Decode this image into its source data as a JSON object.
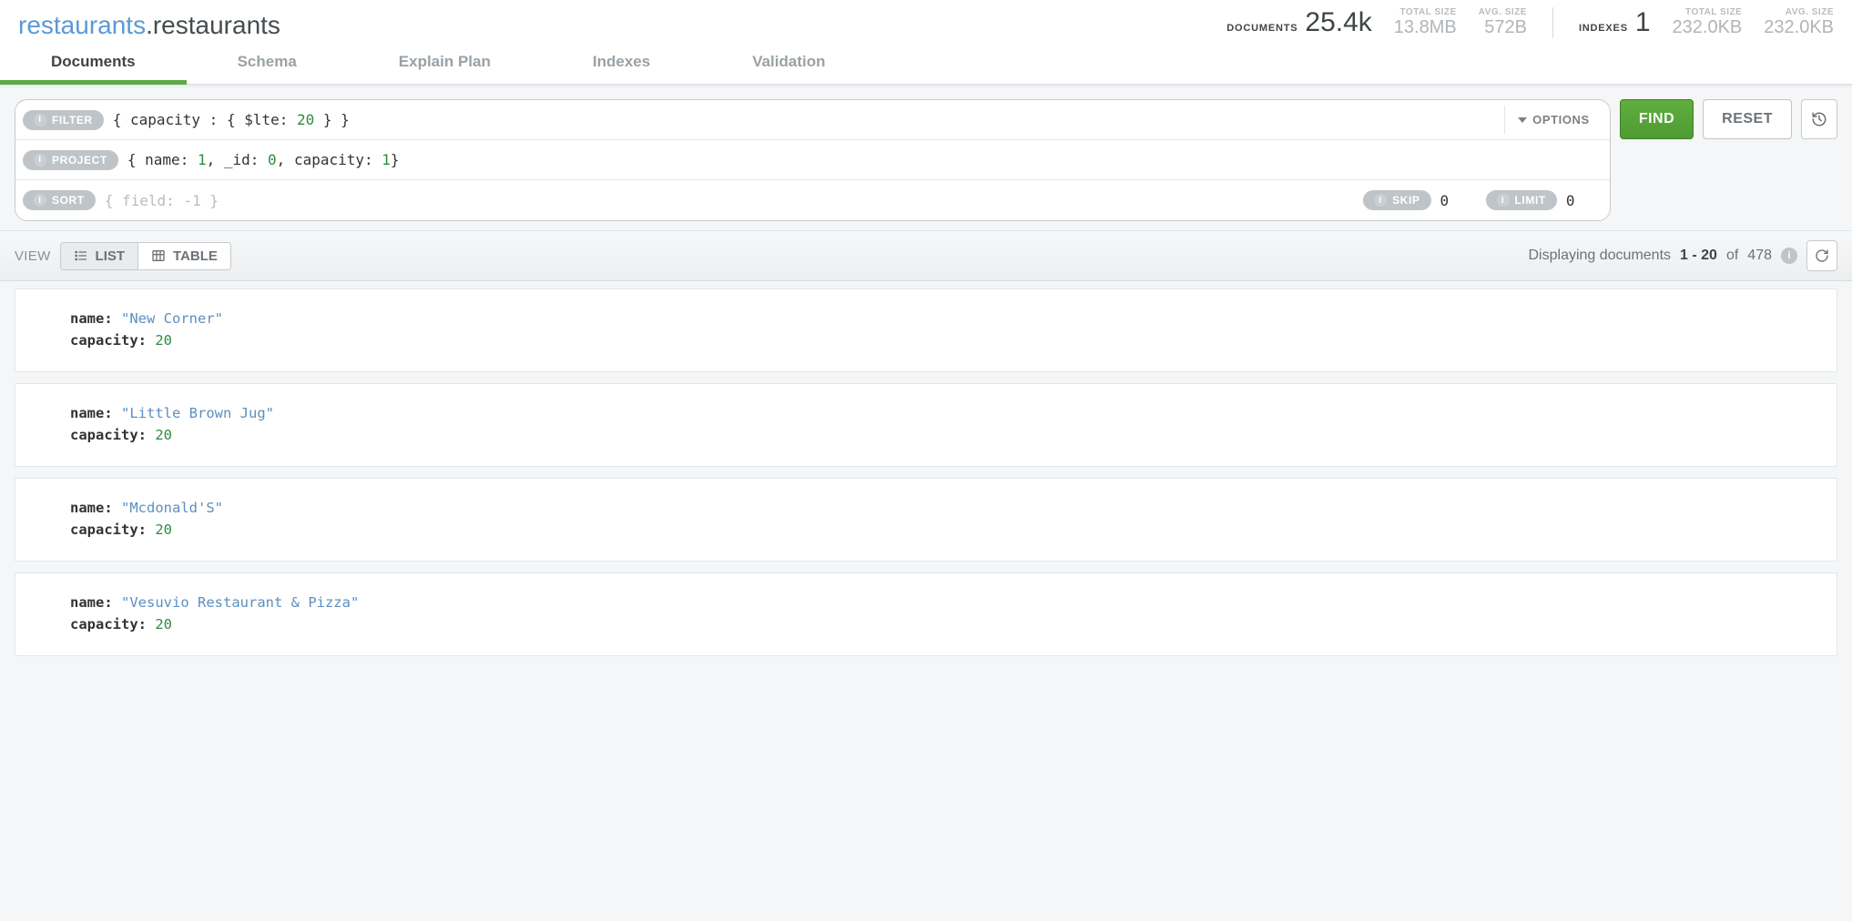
{
  "namespace": {
    "db": "restaurants",
    "coll": "restaurants"
  },
  "stats": {
    "documents": {
      "label": "DOCUMENTS",
      "value": "25.4k"
    },
    "doc_total_size": {
      "label": "TOTAL SIZE",
      "value": "13.8MB"
    },
    "doc_avg_size": {
      "label": "AVG. SIZE",
      "value": "572B"
    },
    "indexes": {
      "label": "INDEXES",
      "value": "1"
    },
    "idx_total_size": {
      "label": "TOTAL SIZE",
      "value": "232.0KB"
    },
    "idx_avg_size": {
      "label": "AVG. SIZE",
      "value": "232.0KB"
    }
  },
  "tabs": {
    "items": [
      {
        "label": "Documents",
        "active": true
      },
      {
        "label": "Schema"
      },
      {
        "label": "Explain Plan"
      },
      {
        "label": "Indexes"
      },
      {
        "label": "Validation"
      }
    ]
  },
  "query": {
    "filter_label": "FILTER",
    "filter_prefix": "{ capacity : { $lte: ",
    "filter_value": "20",
    "filter_suffix": " } }",
    "options_label": "OPTIONS",
    "project_label": "PROJECT",
    "project_value": "{ name: 1, _id: 0, capacity: 1}",
    "project_tokens": {
      "a": "{ name: ",
      "v1": "1",
      "b": ", _id: ",
      "v2": "0",
      "c": ", capacity: ",
      "v3": "1",
      "d": "}"
    },
    "sort_label": "SORT",
    "sort_placeholder": "{ field: -1 }",
    "skip_label": "SKIP",
    "skip_value": "0",
    "limit_label": "LIMIT",
    "limit_value": "0",
    "find_label": "FIND",
    "reset_label": "RESET"
  },
  "toolbar": {
    "view_label": "VIEW",
    "list_label": "LIST",
    "table_label": "TABLE",
    "pager_prefix": "Displaying documents ",
    "pager_range": "1 - 20",
    "pager_of": " of ",
    "pager_total": "478"
  },
  "documents": [
    {
      "name": "\"New Corner\"",
      "capacity": "20"
    },
    {
      "name": "\"Little Brown Jug\"",
      "capacity": "20"
    },
    {
      "name": "\"Mcdonald'S\"",
      "capacity": "20"
    },
    {
      "name": "\"Vesuvio Restaurant & Pizza\"",
      "capacity": "20"
    }
  ],
  "field_labels": {
    "name": "name",
    "capacity": "capacity"
  }
}
